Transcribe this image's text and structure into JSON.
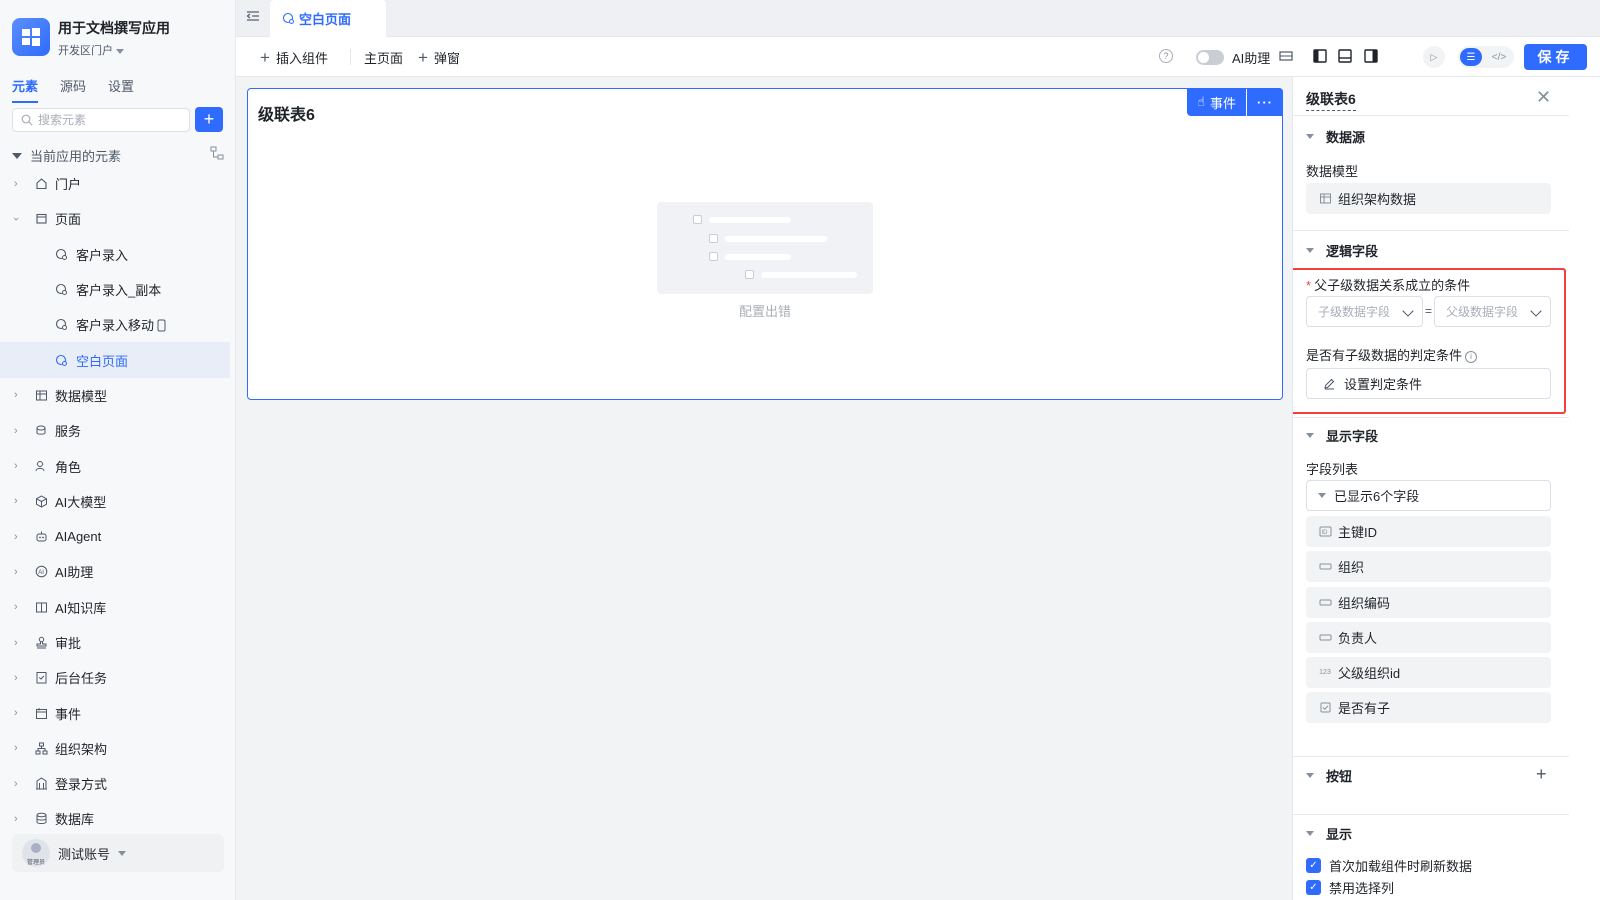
{
  "app": {
    "title": "用于文档撰写应用",
    "portal": "开发区门户"
  },
  "sidebar": {
    "tabs": [
      {
        "label": "元素",
        "active": true
      },
      {
        "label": "源码",
        "active": false
      },
      {
        "label": "设置",
        "active": false
      }
    ],
    "search_placeholder": "搜索元素",
    "tree_header": "当前应用的元素",
    "items": [
      {
        "label": "门户",
        "icon": "home-icon",
        "expandable": true,
        "expanded": false
      },
      {
        "label": "页面",
        "icon": "page-icon",
        "expandable": true,
        "expanded": true
      },
      {
        "label": "客户录入",
        "icon": "page-gear-icon",
        "child": true
      },
      {
        "label": "客户录入_副本",
        "icon": "page-gear-icon",
        "child": true
      },
      {
        "label": "客户录入移动",
        "icon": "page-gear-icon",
        "child": true,
        "mobile": true
      },
      {
        "label": "空白页面",
        "icon": "page-gear-icon",
        "child": true,
        "active": true
      },
      {
        "label": "数据模型",
        "icon": "table-icon",
        "expandable": true
      },
      {
        "label": "服务",
        "icon": "service-icon",
        "expandable": true
      },
      {
        "label": "角色",
        "icon": "role-icon",
        "expandable": true
      },
      {
        "label": "AI大模型",
        "icon": "cube-icon",
        "expandable": true
      },
      {
        "label": "AIAgent",
        "icon": "robot-icon",
        "expandable": true
      },
      {
        "label": "AI助理",
        "icon": "ai-icon",
        "expandable": true
      },
      {
        "label": "AI知识库",
        "icon": "book-icon",
        "expandable": true
      },
      {
        "label": "审批",
        "icon": "stamp-icon",
        "expandable": true
      },
      {
        "label": "后台任务",
        "icon": "task-icon",
        "expandable": true
      },
      {
        "label": "事件",
        "icon": "event-icon",
        "expandable": true
      },
      {
        "label": "组织架构",
        "icon": "org-icon",
        "expandable": true
      },
      {
        "label": "登录方式",
        "icon": "login-icon",
        "expandable": true
      },
      {
        "label": "数据库",
        "icon": "database-icon",
        "expandable": true
      }
    ],
    "account": {
      "name": "测试账号",
      "role_tag": "管理员"
    }
  },
  "tabbar": {
    "active_tab": "空白页面"
  },
  "toolbar": {
    "insert_component": "插入组件",
    "main_page": "主页面",
    "popup": "弹窗",
    "ai_assistant": "AI助理",
    "ai_toggle": false,
    "save": "保存"
  },
  "canvas": {
    "component_title": "级联表6",
    "event_button": "事件",
    "more_button": "···",
    "empty_text": "配置出错"
  },
  "panel": {
    "title": "级联表6",
    "sections": {
      "data_source": "数据源",
      "logic_fields": "逻辑字段",
      "display_fields": "显示字段",
      "buttons": "按钮",
      "display": "显示"
    },
    "data_model_label": "数据模型",
    "data_model_value": "组织架构数据",
    "parent_child_condition_label": "父子级数据关系成立的条件",
    "child_field_placeholder": "子级数据字段",
    "parent_field_placeholder": "父级数据字段",
    "equals": "=",
    "has_child_condition_label": "是否有子级数据的判定条件",
    "set_condition_button": "设置判定条件",
    "field_list_label": "字段列表",
    "fields_shown": "已显示6个字段",
    "fields": [
      {
        "label": "主键ID",
        "icon": "id-icon"
      },
      {
        "label": "组织",
        "icon": "text-field-icon"
      },
      {
        "label": "组织编码",
        "icon": "text-field-icon"
      },
      {
        "label": "负责人",
        "icon": "text-field-icon"
      },
      {
        "label": "父级组织id",
        "icon": "number-field-icon"
      },
      {
        "label": "是否有子",
        "icon": "checkbox-field-icon"
      }
    ],
    "display_options": [
      {
        "label": "首次加载组件时刷新数据",
        "checked": true
      },
      {
        "label": "禁用选择列",
        "checked": true
      }
    ]
  },
  "colors": {
    "accent": "#2f6bff",
    "highlight_border": "#f53f3f"
  }
}
